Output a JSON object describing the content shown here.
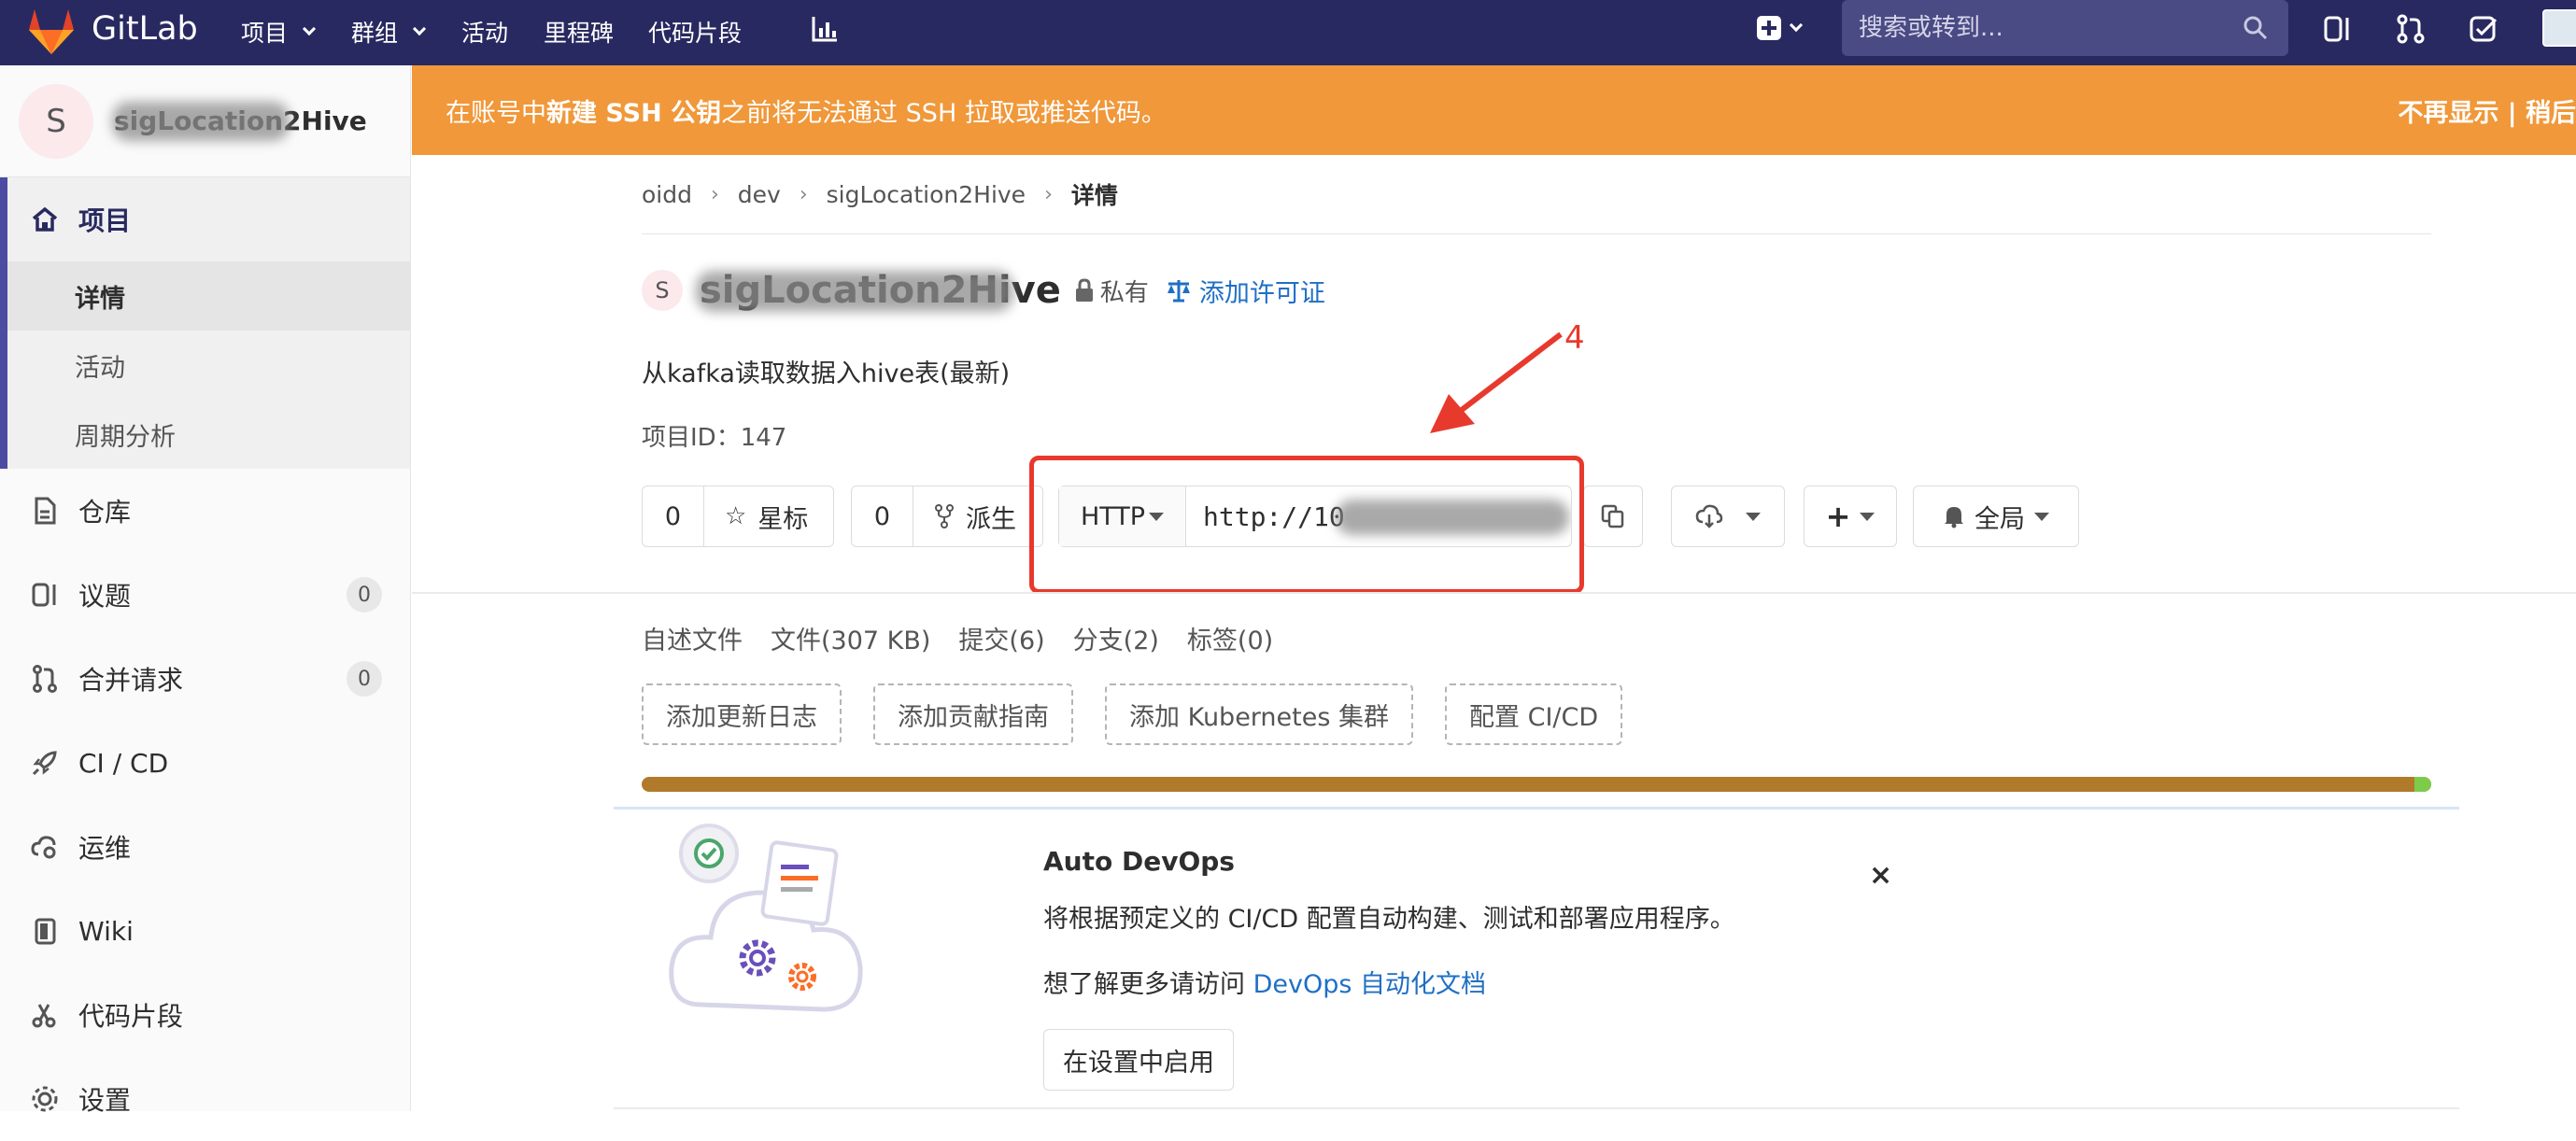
{
  "nav": {
    "brand": "GitLab",
    "items": [
      "项目",
      "群组",
      "活动",
      "里程碑",
      "代码片段"
    ],
    "search_placeholder": "搜索或转到..."
  },
  "sidebar": {
    "avatar_letter": "S",
    "project_name": "sigLocation2Hive",
    "section_title": "项目",
    "sub_items": [
      "详情",
      "活动",
      "周期分析"
    ],
    "items": [
      {
        "label": "仓库",
        "icon": "document-icon"
      },
      {
        "label": "议题",
        "icon": "issues-icon",
        "count": "0"
      },
      {
        "label": "合并请求",
        "icon": "merge-request-icon",
        "count": "0"
      },
      {
        "label": "CI / CD",
        "icon": "rocket-icon"
      },
      {
        "label": "运维",
        "icon": "cloud-gear-icon"
      },
      {
        "label": "Wiki",
        "icon": "book-icon"
      },
      {
        "label": "代码片段",
        "icon": "scissors-icon"
      },
      {
        "label": "设置",
        "icon": "gear-icon"
      }
    ]
  },
  "banner": {
    "text_pre": "在账号中 ",
    "text_bold": "新建 SSH 公钥",
    "text_post": " 之前将无法通过 SSH 拉取或推送代码。",
    "right": "不再显示 | 稍后"
  },
  "breadcrumb": [
    "oidd",
    "dev",
    "sigLocation2Hive",
    "详情"
  ],
  "project": {
    "avatar_letter": "S",
    "title": "sigLocation2Hive",
    "visibility": "私有",
    "license_link": "添加许可证",
    "description": "从kafka读取数据入hive表(最新)",
    "id_label": "项目ID：147"
  },
  "actions": {
    "star_count": "0",
    "star_label": "星标",
    "fork_count": "0",
    "fork_label": "派生",
    "clone_protocol": "HTTP",
    "clone_url": "http://10",
    "notify_label": "全局"
  },
  "annotation": {
    "number": "4",
    "color": "#e8392d"
  },
  "tabs": [
    "自述文件",
    "文件(307 KB)",
    "提交(6)",
    "分支(2)",
    "标签(0)"
  ],
  "add_buttons": [
    "添加更新日志",
    "添加贡献指南",
    "添加 Kubernetes 集群",
    "配置 CI/CD"
  ],
  "devops": {
    "title": "Auto DevOps",
    "description": "将根据预定义的 CI/CD 配置自动构建、测试和部署应用程序。",
    "more_pre": "想了解更多请访问 ",
    "more_link": "DevOps 自动化文档",
    "enable_button": "在设置中启用",
    "close": "×"
  },
  "colors": {
    "nav_bg": "#292961",
    "banner_bg": "#f0983a",
    "link": "#1f6fc5",
    "annotation": "#e8392d",
    "lang_bar_main": "#b07a2a",
    "lang_bar_secondary": "#7ecb4a"
  }
}
